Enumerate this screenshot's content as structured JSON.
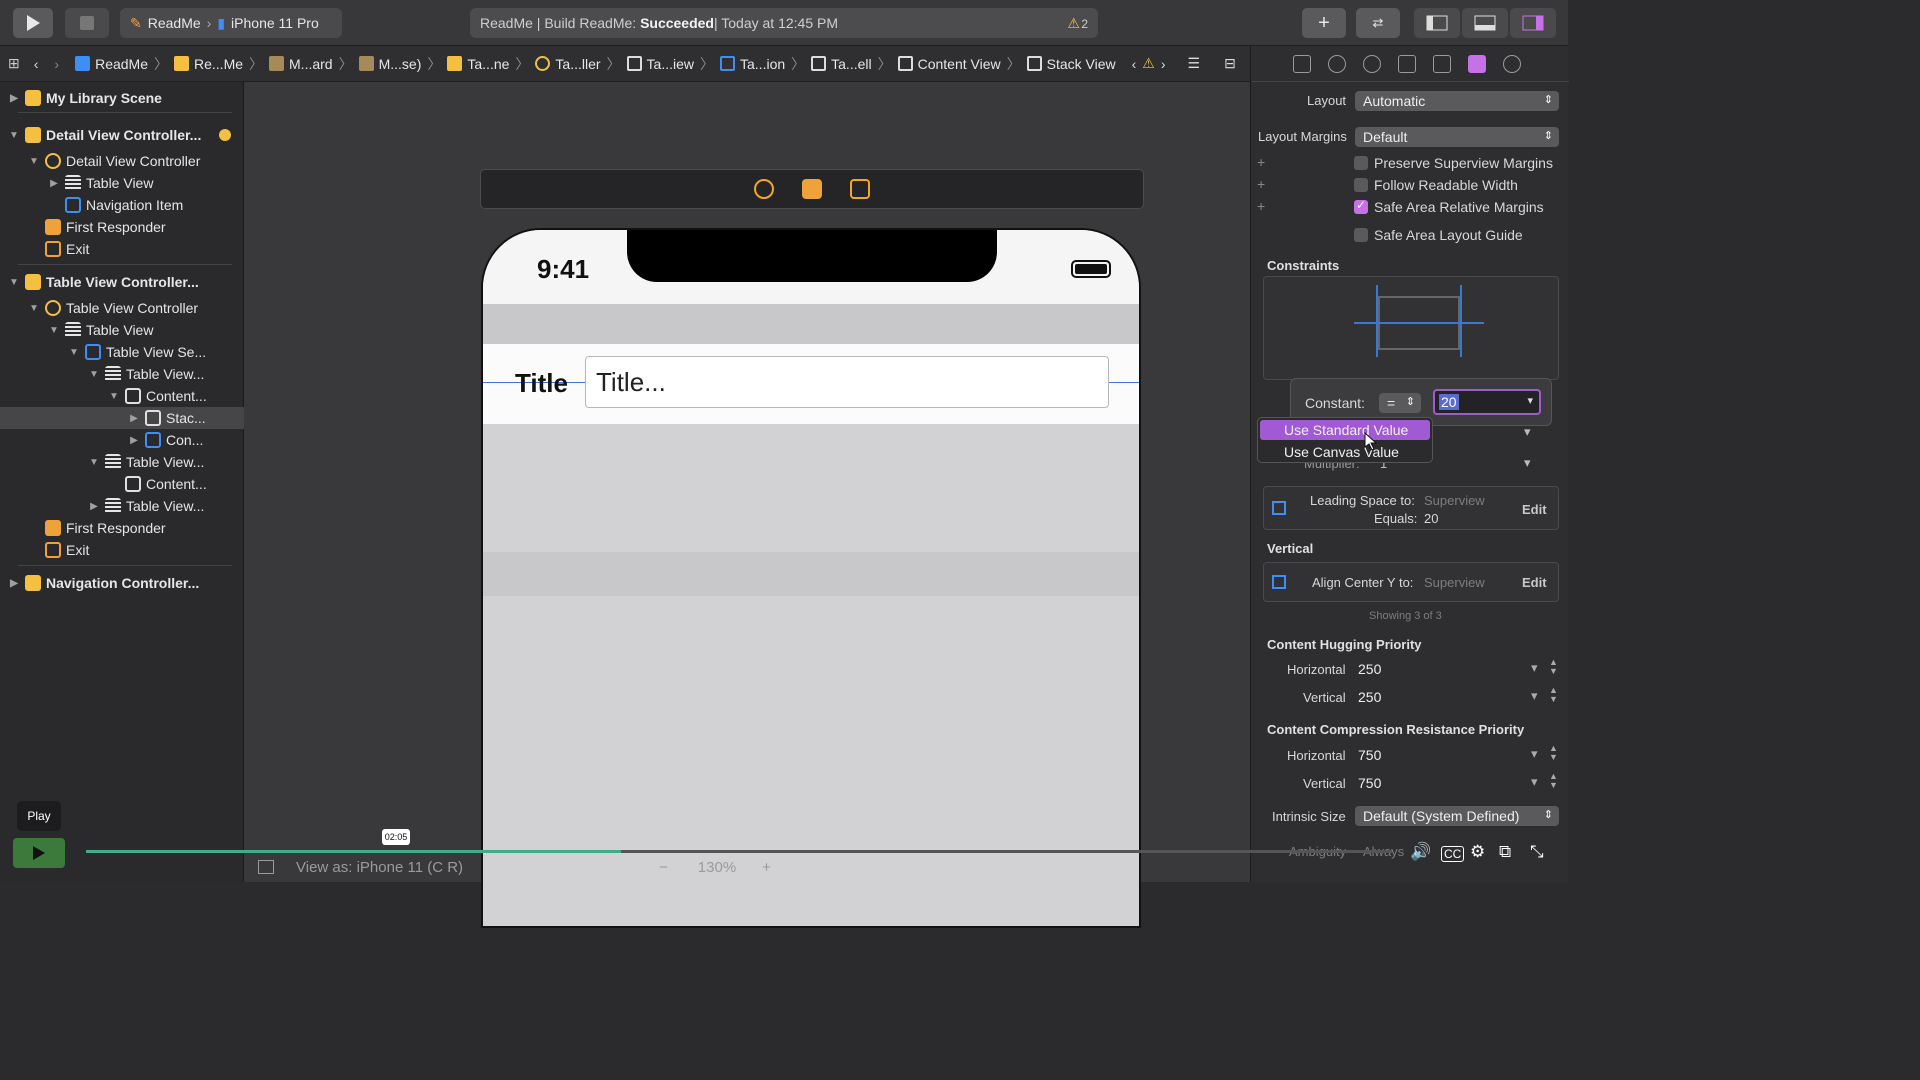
{
  "toolbar": {
    "scheme_target": "ReadMe",
    "scheme_device": "iPhone 11 Pro",
    "status_prefix": "ReadMe | Build ReadMe: ",
    "status_result": "Succeeded",
    "status_time": " | Today at 12:45 PM",
    "warning_count": "2"
  },
  "jumpbar": {
    "crumbs": [
      "ReadMe",
      "Re...Me",
      "M...ard",
      "M...se)",
      "Ta...ne",
      "Ta...ller",
      "Ta...iew",
      "Ta...ion",
      "Ta...ell",
      "Content View",
      "Stack View"
    ]
  },
  "outline": {
    "rows": [
      {
        "label": "My Library Scene"
      },
      {
        "label": "Detail View Controller..."
      },
      {
        "label": "Detail View Controller"
      },
      {
        "label": "Table View"
      },
      {
        "label": "Navigation Item"
      },
      {
        "label": "First Responder"
      },
      {
        "label": "Exit"
      },
      {
        "label": "Table View Controller..."
      },
      {
        "label": "Table View Controller"
      },
      {
        "label": "Table View"
      },
      {
        "label": "Table View Se..."
      },
      {
        "label": "Table View..."
      },
      {
        "label": "Content..."
      },
      {
        "label": "Stac..."
      },
      {
        "label": "Con..."
      },
      {
        "label": "Table View..."
      },
      {
        "label": "Content..."
      },
      {
        "label": "Table View..."
      },
      {
        "label": "First Responder"
      },
      {
        "label": "Exit"
      },
      {
        "label": "Navigation Controller..."
      }
    ]
  },
  "device": {
    "time": "9:41",
    "cell_title": "Title",
    "cell_placeholder": "Title..."
  },
  "inspector": {
    "layout_label": "Layout",
    "layout_value": "Automatic",
    "margins_label": "Layout Margins",
    "margins_value": "Default",
    "checkboxes": [
      {
        "label": "Preserve Superview Margins",
        "checked": false
      },
      {
        "label": "Follow Readable Width",
        "checked": false
      },
      {
        "label": "Safe Area Relative Margins",
        "checked": true
      },
      {
        "label": "Safe Area Layout Guide",
        "checked": false
      }
    ],
    "constraints_title": "Constraints",
    "constant_label": "Constant:",
    "constant_relation": "=",
    "constant_value": "20",
    "multiplier_label": "Multiplier:",
    "multiplier_value": "1",
    "leading_label": "Leading Space to:",
    "leading_target": "Superview",
    "leading_equals": "Equals:",
    "leading_value": "20",
    "edit_label": "Edit",
    "vertical_title": "Vertical",
    "align_label": "Align Center Y to:",
    "align_target": "Superview",
    "showing": "Showing 3 of 3",
    "hugging_title": "Content Hugging Priority",
    "compression_title": "Content Compression Resistance Priority",
    "horizontal_label": "Horizontal",
    "vertical_label": "Vertical",
    "hugging_h": "250",
    "hugging_v": "250",
    "compression_h": "750",
    "compression_v": "750",
    "intrinsic_label": "Intrinsic Size",
    "intrinsic_value": "Default (System Defined)",
    "ambiguity_label": "Ambiguity",
    "ambiguity_value": "Always"
  },
  "menu": {
    "items": [
      "Use Standard Value",
      "Use Canvas Value"
    ]
  },
  "canvasbar": {
    "view_as": "View as: iPhone 11 (",
    "view_as_tail": "C   R)",
    "zoom": "130%"
  },
  "player": {
    "tip": "Play",
    "timestamp": "02:05",
    "progress": 0.41
  },
  "colors": {
    "accent": "#c671e6",
    "selection": "#a259d4",
    "constraint": "#3a78d8",
    "warning": "#f5c042"
  }
}
